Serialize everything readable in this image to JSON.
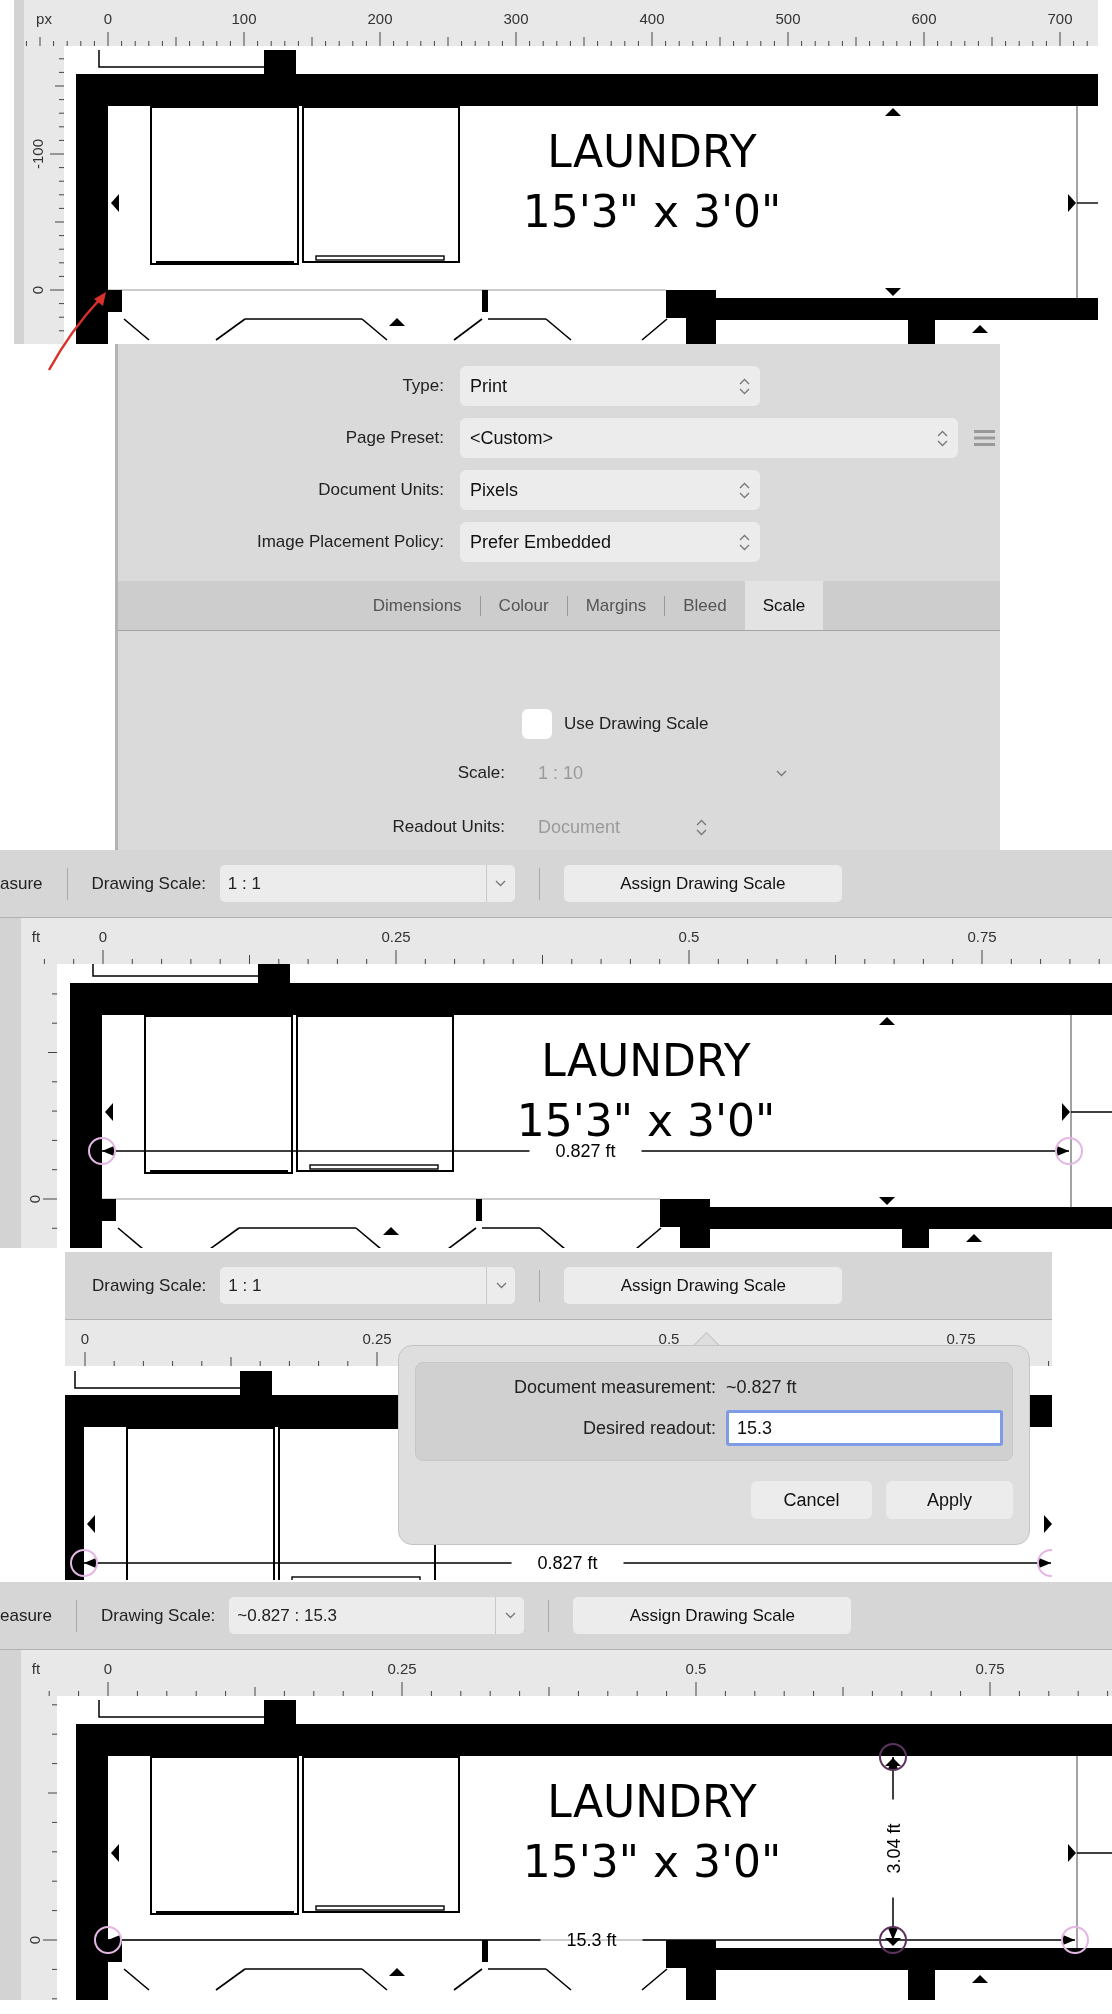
{
  "canvas_1": {
    "ruler": {
      "unit": "px",
      "x_labels": [
        "0",
        "100",
        "200",
        "300",
        "400",
        "500",
        "600",
        "700"
      ],
      "y_labels": [
        "-100",
        "0"
      ]
    },
    "room": {
      "name": "LAUNDRY",
      "size": "15'3\" x 3'0\""
    }
  },
  "document_setup": {
    "fields": [
      {
        "label": "Type:",
        "value": "Print",
        "kind": "popup"
      },
      {
        "label": "Page Preset:",
        "value": "<Custom>",
        "kind": "wide"
      },
      {
        "label": "Document Units:",
        "value": "Pixels",
        "kind": "popup"
      },
      {
        "label": "Image Placement Policy:",
        "value": "Prefer Embedded",
        "kind": "popup"
      }
    ],
    "tabs": [
      {
        "label": "Dimensions",
        "selected": false
      },
      {
        "label": "Colour",
        "selected": false
      },
      {
        "label": "Margins",
        "selected": false
      },
      {
        "label": "Bleed",
        "selected": false
      },
      {
        "label": "Scale",
        "selected": true
      }
    ],
    "use_drawing_scale": {
      "label": "Use Drawing Scale",
      "checked": false
    },
    "scale": {
      "label": "Scale:",
      "value": "1 : 10",
      "disabled": true
    },
    "readout_units": {
      "label": "Readout Units:",
      "value": "Document",
      "disabled": true
    }
  },
  "canvas_2": {
    "toolbar": {
      "cut_label": "asure",
      "scale_label": "Drawing Scale:",
      "scale_value": "1 : 1",
      "assign_button": "Assign Drawing Scale"
    },
    "ruler": {
      "unit": "ft",
      "x_labels": [
        "0",
        "0.25",
        "0.5",
        "0.75"
      ],
      "y_labels": [
        "0"
      ]
    },
    "room": {
      "name": "LAUNDRY",
      "size": "15'3\" x 3'0\""
    },
    "measurements": [
      {
        "kind": "across",
        "label": "0.827 ft"
      }
    ]
  },
  "canvas_3": {
    "toolbar": {
      "scale_label": "Drawing Scale:",
      "scale_value": "1 : 1",
      "assign_button": "Assign Drawing Scale"
    },
    "ruler": {
      "x_labels": [
        "0",
        "0.25",
        "0.5",
        "0.75"
      ]
    },
    "measurements": [
      {
        "kind": "across",
        "label": "0.827 ft"
      }
    ],
    "popover": {
      "measurement_label": "Document measurement:",
      "measurement_value": "~0.827 ft",
      "readout_label": "Desired readout:",
      "readout_value": "15.3",
      "buttons": [
        "Cancel",
        "Apply"
      ]
    }
  },
  "canvas_4": {
    "toolbar": {
      "cut_label": "easure",
      "scale_label": "Drawing Scale:",
      "scale_value": "~0.827 : 15.3",
      "assign_button": "Assign Drawing Scale"
    },
    "ruler": {
      "unit": "ft",
      "x_labels": [
        "0",
        "0.25",
        "0.5",
        "0.75"
      ],
      "y_labels": [
        "0"
      ]
    },
    "room": {
      "name": "LAUNDRY",
      "size": "15'3\" x 3'0\""
    },
    "measurements": [
      {
        "kind": "floor",
        "label": "15.3 ft"
      },
      {
        "kind": "height",
        "label": "3.04 ft"
      }
    ]
  }
}
